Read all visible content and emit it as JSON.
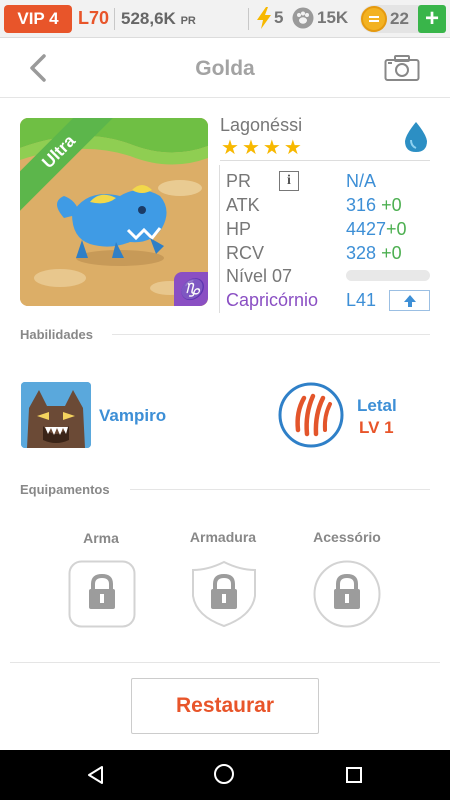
{
  "status_bar": {
    "vip": "VIP 4",
    "level": "L70",
    "pr_value": "528,6K",
    "pr_unit": "PR",
    "energy": "5",
    "food": "15K",
    "gems": "22",
    "add_label": "+"
  },
  "header": {
    "title": "Golda",
    "back_icon": "chevron-left-icon",
    "camera_icon": "camera-icon"
  },
  "monster": {
    "rarity": "Ultra",
    "name": "Lagonéssi",
    "stars": 4,
    "element_icon": "water-drop-icon",
    "sign_badge": "♑",
    "stats": {
      "pr_label": "PR",
      "pr_value": "N/A",
      "atk_label": "ATK",
      "atk_value": "316",
      "atk_bonus": "+0",
      "hp_label": "HP",
      "hp_value": "4427",
      "hp_bonus": "+0",
      "rcv_label": "RCV",
      "rcv_value": "328",
      "rcv_bonus": "+0",
      "level_label": "Nível 07",
      "xp_progress": 0
    },
    "sign_label": "Capricórnio",
    "sign_level": "L41"
  },
  "abilities": {
    "section_title": "Habilidades",
    "skill_name": "Vampiro",
    "trait_name": "Letal",
    "trait_level": "LV 1"
  },
  "equipment": {
    "section_title": "Equipamentos",
    "slots": [
      {
        "label": "Arma",
        "icon": "lock-icon"
      },
      {
        "label": "Armadura",
        "icon": "lock-icon"
      },
      {
        "label": "Acessório",
        "icon": "lock-icon"
      }
    ]
  },
  "actions": {
    "restore_label": "Restaurar"
  },
  "colors": {
    "accent_orange": "#e8552a",
    "accent_blue": "#3d8fd6",
    "bonus_green": "#4caf50",
    "sign_purple": "#8a4fc3",
    "star_yellow": "#f7b800"
  }
}
